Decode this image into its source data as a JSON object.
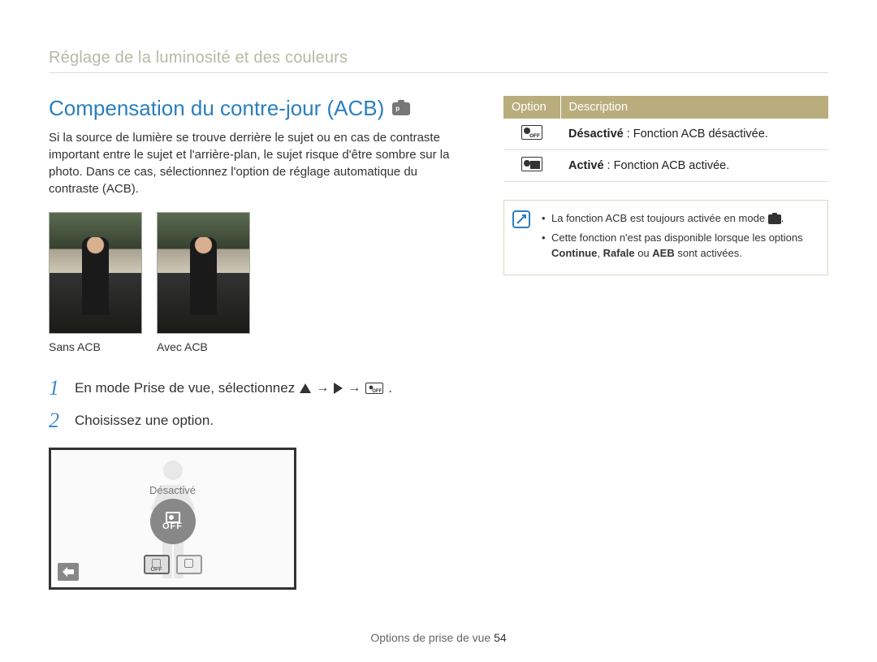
{
  "breadcrumb": "Réglage de la luminosité et des couleurs",
  "heading": "Compensation du contre-jour (ACB)",
  "mode_badge": "p",
  "intro": "Si la source de lumière se trouve derrière le sujet ou en cas de contraste important entre le sujet et l'arrière-plan, le sujet risque d'être sombre sur la photo. Dans ce cas, sélectionnez l'option de réglage automatique du contraste (ACB).",
  "thumb_labels": {
    "left": "Sans ACB",
    "right": "Avec ACB"
  },
  "steps": {
    "s1_num": "1",
    "s1_text": "En mode Prise de vue, sélectionnez",
    "s1_tail": ".",
    "s2_num": "2",
    "s2_text": "Choisissez une option."
  },
  "screen": {
    "label": "Désactivé",
    "off_text": "OFF",
    "chip1": "OFF",
    "chip2": ""
  },
  "table": {
    "head_opt": "Option",
    "head_desc": "Description",
    "rows": [
      {
        "icon": "off",
        "bold": "Désactivé",
        "rest": " : Fonction ACB désactivée."
      },
      {
        "icon": "on",
        "bold": "Activé",
        "rest": " : Fonction ACB activée."
      }
    ]
  },
  "note": {
    "l1_a": "La fonction ACB est toujours activée en mode ",
    "l1_b": ".",
    "l2_a": "Cette fonction n'est pas disponible lorsque les options ",
    "l2_bold1": "Continue",
    "l2_mid": ", ",
    "l2_bold2": "Rafale",
    "l2_mid2": "  ou ",
    "l2_bold3": "AEB",
    "l2_end": " sont activées."
  },
  "footer": {
    "section": "Options de prise de vue ",
    "page": "54"
  }
}
